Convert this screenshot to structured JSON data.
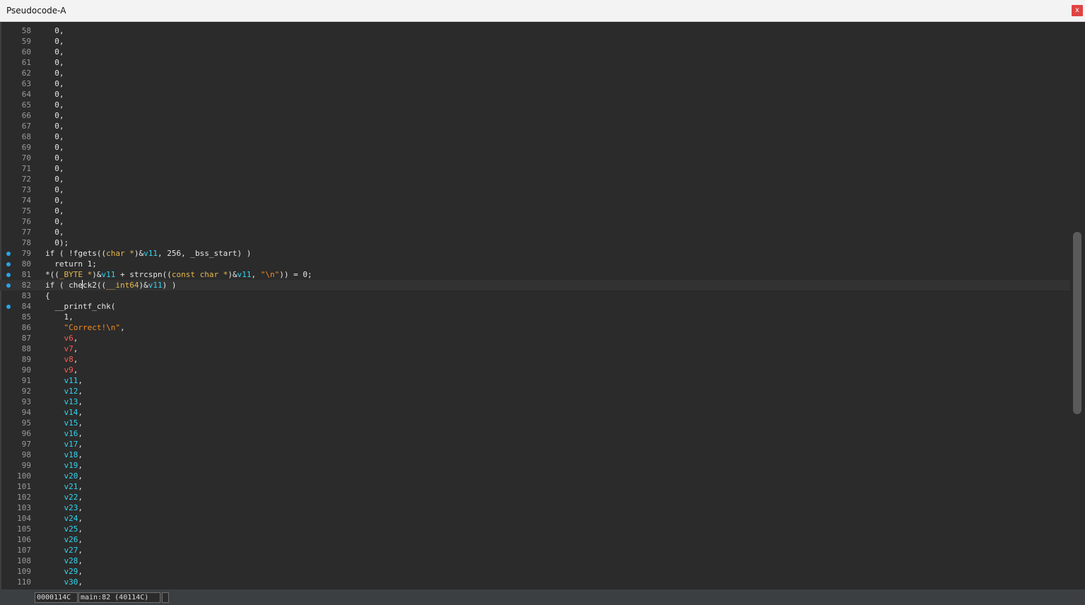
{
  "window": {
    "title": "Pseudocode-A",
    "close_label": "x"
  },
  "status": {
    "address": "0000114C",
    "location": "main:82 (40114C)",
    "extra": ""
  },
  "editor": {
    "current_line": 82,
    "lines": [
      {
        "n": "58",
        "bp": false,
        "t": [
          [
            "  0,",
            ""
          ]
        ]
      },
      {
        "n": "59",
        "bp": false,
        "t": [
          [
            "  0,",
            ""
          ]
        ]
      },
      {
        "n": "60",
        "bp": false,
        "t": [
          [
            "  0,",
            ""
          ]
        ]
      },
      {
        "n": "61",
        "bp": false,
        "t": [
          [
            "  0,",
            ""
          ]
        ]
      },
      {
        "n": "62",
        "bp": false,
        "t": [
          [
            "  0,",
            ""
          ]
        ]
      },
      {
        "n": "63",
        "bp": false,
        "t": [
          [
            "  0,",
            ""
          ]
        ]
      },
      {
        "n": "64",
        "bp": false,
        "t": [
          [
            "  0,",
            ""
          ]
        ]
      },
      {
        "n": "65",
        "bp": false,
        "t": [
          [
            "  0,",
            ""
          ]
        ]
      },
      {
        "n": "66",
        "bp": false,
        "t": [
          [
            "  0,",
            ""
          ]
        ]
      },
      {
        "n": "67",
        "bp": false,
        "t": [
          [
            "  0,",
            ""
          ]
        ]
      },
      {
        "n": "68",
        "bp": false,
        "t": [
          [
            "  0,",
            ""
          ]
        ]
      },
      {
        "n": "69",
        "bp": false,
        "t": [
          [
            "  0,",
            ""
          ]
        ]
      },
      {
        "n": "70",
        "bp": false,
        "t": [
          [
            "  0,",
            ""
          ]
        ]
      },
      {
        "n": "71",
        "bp": false,
        "t": [
          [
            "  0,",
            ""
          ]
        ]
      },
      {
        "n": "72",
        "bp": false,
        "t": [
          [
            "  0,",
            ""
          ]
        ]
      },
      {
        "n": "73",
        "bp": false,
        "t": [
          [
            "  0,",
            ""
          ]
        ]
      },
      {
        "n": "74",
        "bp": false,
        "t": [
          [
            "  0,",
            ""
          ]
        ]
      },
      {
        "n": "75",
        "bp": false,
        "t": [
          [
            "  0,",
            ""
          ]
        ]
      },
      {
        "n": "76",
        "bp": false,
        "t": [
          [
            "  0,",
            ""
          ]
        ]
      },
      {
        "n": "77",
        "bp": false,
        "t": [
          [
            "  0,",
            ""
          ]
        ]
      },
      {
        "n": "78",
        "bp": false,
        "t": [
          [
            "  0);",
            ""
          ]
        ]
      },
      {
        "n": "79",
        "bp": true,
        "t": [
          [
            "if ( !fgets((",
            ""
          ],
          [
            "char *",
            "type"
          ],
          [
            ")&",
            ""
          ],
          [
            "v11",
            "var"
          ],
          [
            ", 256, _bss_start) )",
            ""
          ]
        ]
      },
      {
        "n": "80",
        "bp": true,
        "t": [
          [
            "  return 1;",
            ""
          ]
        ]
      },
      {
        "n": "81",
        "bp": true,
        "t": [
          [
            "*((",
            ""
          ],
          [
            "_BYTE *",
            "type"
          ],
          [
            ")&",
            ""
          ],
          [
            "v11",
            "var"
          ],
          [
            " + strcspn((",
            ""
          ],
          [
            "const char *",
            "type"
          ],
          [
            ")&",
            ""
          ],
          [
            "v11",
            "var"
          ],
          [
            ", ",
            ""
          ],
          [
            "\"\\n\"",
            "str"
          ],
          [
            ")) = 0;",
            ""
          ]
        ]
      },
      {
        "n": "82",
        "bp": true,
        "t": [
          [
            "if ( che",
            ""
          ],
          [
            "|",
            "cursor"
          ],
          [
            "ck2((",
            ""
          ],
          [
            "__int64",
            "type"
          ],
          [
            ")&",
            ""
          ],
          [
            "v11",
            "var"
          ],
          [
            ") )",
            ""
          ]
        ]
      },
      {
        "n": "83",
        "bp": false,
        "t": [
          [
            "{",
            ""
          ]
        ]
      },
      {
        "n": "84",
        "bp": true,
        "t": [
          [
            "  __printf_chk(",
            ""
          ]
        ]
      },
      {
        "n": "85",
        "bp": false,
        "t": [
          [
            "    1,",
            ""
          ]
        ]
      },
      {
        "n": "86",
        "bp": false,
        "t": [
          [
            "    ",
            ""
          ],
          [
            "\"Correct!\\n\"",
            "str"
          ],
          [
            ",",
            ""
          ]
        ]
      },
      {
        "n": "87",
        "bp": false,
        "t": [
          [
            "    ",
            ""
          ],
          [
            "v6",
            "red"
          ],
          [
            ",",
            ""
          ]
        ]
      },
      {
        "n": "88",
        "bp": false,
        "t": [
          [
            "    ",
            ""
          ],
          [
            "v7",
            "red"
          ],
          [
            ",",
            ""
          ]
        ]
      },
      {
        "n": "89",
        "bp": false,
        "t": [
          [
            "    ",
            ""
          ],
          [
            "v8",
            "red"
          ],
          [
            ",",
            ""
          ]
        ]
      },
      {
        "n": "90",
        "bp": false,
        "t": [
          [
            "    ",
            ""
          ],
          [
            "v9",
            "red"
          ],
          [
            ",",
            ""
          ]
        ]
      },
      {
        "n": "91",
        "bp": false,
        "t": [
          [
            "    ",
            ""
          ],
          [
            "v11",
            "var"
          ],
          [
            ",",
            ""
          ]
        ]
      },
      {
        "n": "92",
        "bp": false,
        "t": [
          [
            "    ",
            ""
          ],
          [
            "v12",
            "var"
          ],
          [
            ",",
            ""
          ]
        ]
      },
      {
        "n": "93",
        "bp": false,
        "t": [
          [
            "    ",
            ""
          ],
          [
            "v13",
            "var"
          ],
          [
            ",",
            ""
          ]
        ]
      },
      {
        "n": "94",
        "bp": false,
        "t": [
          [
            "    ",
            ""
          ],
          [
            "v14",
            "var"
          ],
          [
            ",",
            ""
          ]
        ]
      },
      {
        "n": "95",
        "bp": false,
        "t": [
          [
            "    ",
            ""
          ],
          [
            "v15",
            "var"
          ],
          [
            ",",
            ""
          ]
        ]
      },
      {
        "n": "96",
        "bp": false,
        "t": [
          [
            "    ",
            ""
          ],
          [
            "v16",
            "var"
          ],
          [
            ",",
            ""
          ]
        ]
      },
      {
        "n": "97",
        "bp": false,
        "t": [
          [
            "    ",
            ""
          ],
          [
            "v17",
            "var"
          ],
          [
            ",",
            ""
          ]
        ]
      },
      {
        "n": "98",
        "bp": false,
        "t": [
          [
            "    ",
            ""
          ],
          [
            "v18",
            "var"
          ],
          [
            ",",
            ""
          ]
        ]
      },
      {
        "n": "99",
        "bp": false,
        "t": [
          [
            "    ",
            ""
          ],
          [
            "v19",
            "var"
          ],
          [
            ",",
            ""
          ]
        ]
      },
      {
        "n": "100",
        "bp": false,
        "t": [
          [
            "    ",
            ""
          ],
          [
            "v20",
            "var"
          ],
          [
            ",",
            ""
          ]
        ]
      },
      {
        "n": "101",
        "bp": false,
        "t": [
          [
            "    ",
            ""
          ],
          [
            "v21",
            "var"
          ],
          [
            ",",
            ""
          ]
        ]
      },
      {
        "n": "102",
        "bp": false,
        "t": [
          [
            "    ",
            ""
          ],
          [
            "v22",
            "var"
          ],
          [
            ",",
            ""
          ]
        ]
      },
      {
        "n": "103",
        "bp": false,
        "t": [
          [
            "    ",
            ""
          ],
          [
            "v23",
            "var"
          ],
          [
            ",",
            ""
          ]
        ]
      },
      {
        "n": "104",
        "bp": false,
        "t": [
          [
            "    ",
            ""
          ],
          [
            "v24",
            "var"
          ],
          [
            ",",
            ""
          ]
        ]
      },
      {
        "n": "105",
        "bp": false,
        "t": [
          [
            "    ",
            ""
          ],
          [
            "v25",
            "var"
          ],
          [
            ",",
            ""
          ]
        ]
      },
      {
        "n": "106",
        "bp": false,
        "t": [
          [
            "    ",
            ""
          ],
          [
            "v26",
            "var"
          ],
          [
            ",",
            ""
          ]
        ]
      },
      {
        "n": "107",
        "bp": false,
        "t": [
          [
            "    ",
            ""
          ],
          [
            "v27",
            "var"
          ],
          [
            ",",
            ""
          ]
        ]
      },
      {
        "n": "108",
        "bp": false,
        "t": [
          [
            "    ",
            ""
          ],
          [
            "v28",
            "var"
          ],
          [
            ",",
            ""
          ]
        ]
      },
      {
        "n": "109",
        "bp": false,
        "t": [
          [
            "    ",
            ""
          ],
          [
            "v29",
            "var"
          ],
          [
            ",",
            ""
          ]
        ]
      },
      {
        "n": "110",
        "bp": false,
        "t": [
          [
            "    ",
            ""
          ],
          [
            "v30",
            "var"
          ],
          [
            ",",
            ""
          ]
        ]
      }
    ]
  }
}
